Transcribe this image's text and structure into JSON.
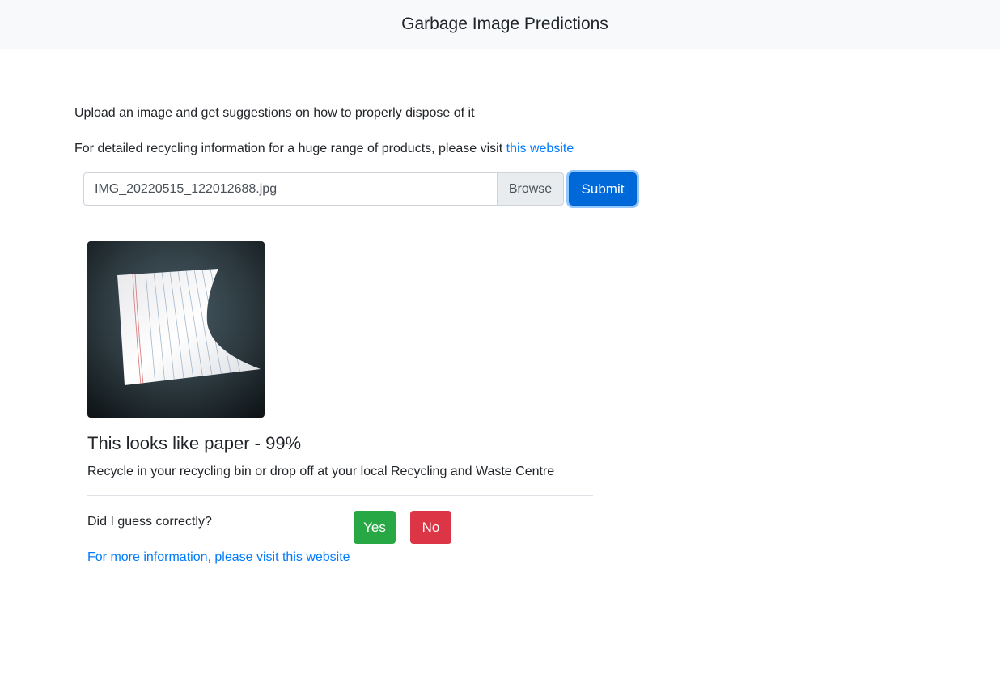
{
  "navbar": {
    "title": "Garbage Image Predictions"
  },
  "intro": {
    "line1": "Upload an image and get suggestions on how to properly dispose of it",
    "line2_prefix": "For detailed recycling information for a huge range of products, please visit ",
    "line2_link": "this website"
  },
  "upload": {
    "file_name": "IMG_20220515_122012688.jpg",
    "browse_label": "Browse",
    "submit_label": "Submit"
  },
  "result": {
    "title": "This looks like paper - 99%",
    "disposal": "Recycle in your recycling bin or drop off at your local Recycling and Waste Centre",
    "question": "Did I guess correctly?",
    "yes_label": "Yes",
    "no_label": "No",
    "more_info_link": "For more information, please visit this website"
  },
  "colors": {
    "link": "#007bff",
    "primary": "#0069d9",
    "success": "#28a745",
    "danger": "#dc3545",
    "navbar_bg": "#f8f9fa"
  }
}
